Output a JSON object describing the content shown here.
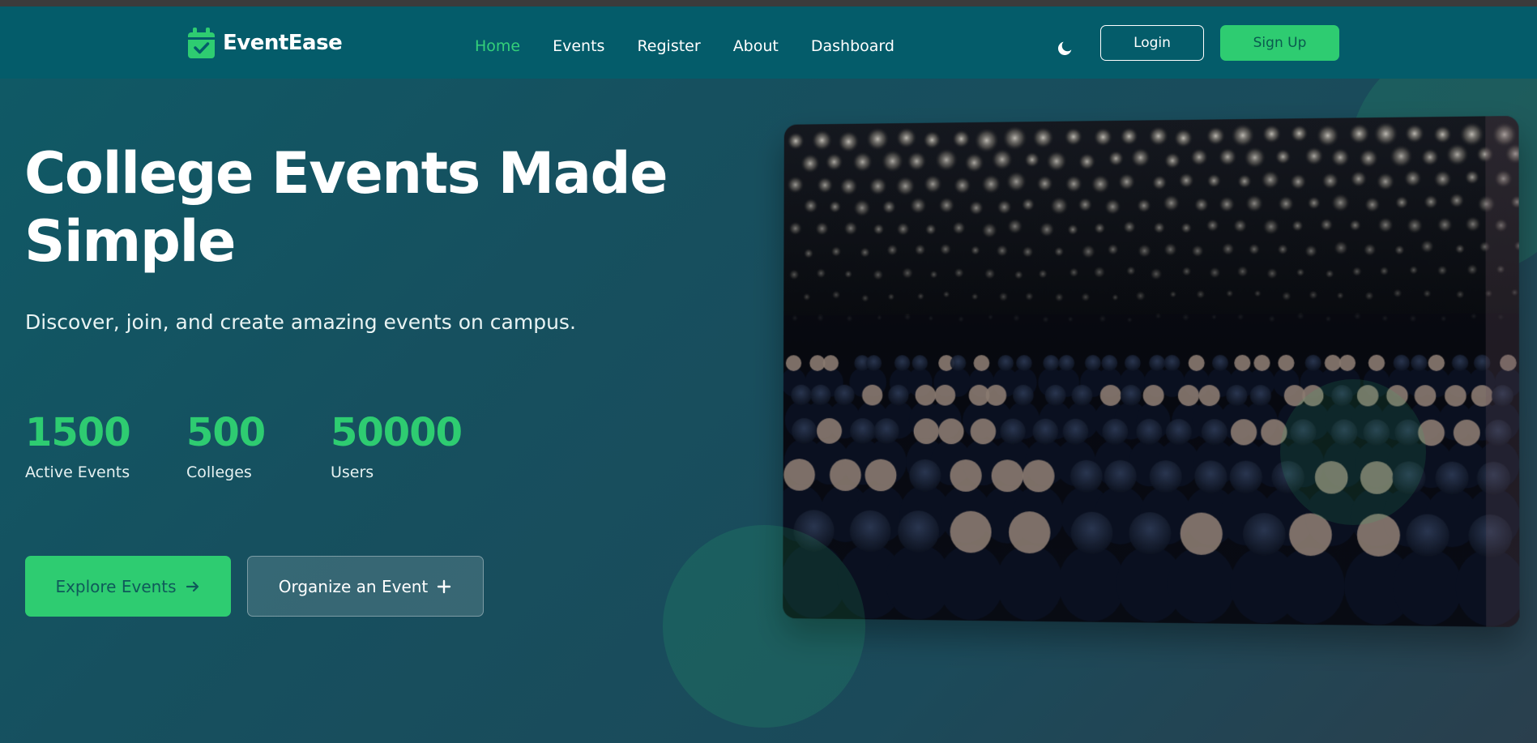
{
  "brand": {
    "name": "EventEase",
    "icon": "calendar-check-icon"
  },
  "nav": {
    "links": [
      {
        "label": "Home",
        "active": true
      },
      {
        "label": "Events",
        "active": false
      },
      {
        "label": "Register",
        "active": false
      },
      {
        "label": "About",
        "active": false
      },
      {
        "label": "Dashboard",
        "active": false
      }
    ],
    "theme_icon": "moon-icon",
    "login_label": "Login",
    "signup_label": "Sign Up"
  },
  "hero": {
    "title": "College Events Made Simple",
    "subtitle": "Discover, join, and create amazing events on campus.",
    "stats": [
      {
        "value": "1500",
        "label": "Active Events"
      },
      {
        "value": "500",
        "label": "Colleges"
      },
      {
        "value": "50000",
        "label": "Users"
      }
    ],
    "explore_label": "Explore Events",
    "explore_icon": "arrow-right-icon",
    "organize_label": "Organize an Event",
    "organize_icon": "plus-icon",
    "image": "conference-audience-photo"
  },
  "colors": {
    "accent": "#2ecc71",
    "navbar_bg": "#045c6a",
    "hero_bg": "#16505f",
    "text": "#ffffff"
  }
}
